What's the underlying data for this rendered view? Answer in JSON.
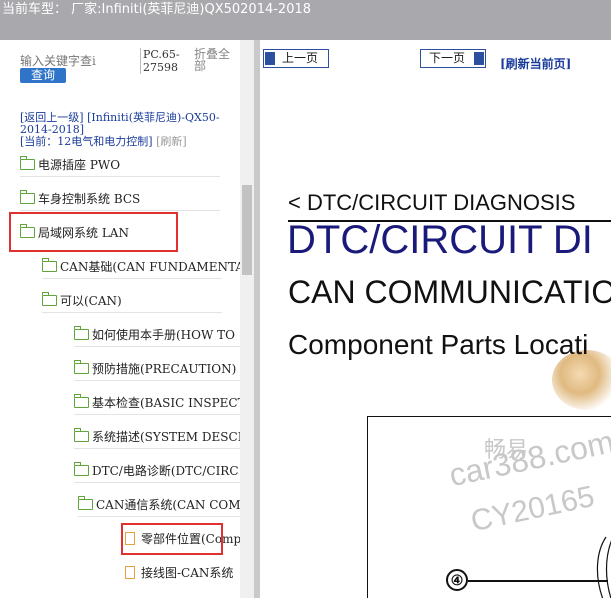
{
  "title_bar": {
    "text": "当前车型： 厂家:Infiniti(英菲尼迪)QX502014-2018"
  },
  "sidebar": {
    "search": {
      "placeholder": "输入关键字查i",
      "button_label": "查询"
    },
    "pc_label": "PC.65-27598",
    "collapse_all": "折叠全部",
    "nav": {
      "back": "[返回上一级]",
      "vehicle": "[Infiniti(英菲尼迪)-QX50-2014-2018]",
      "current": "[当前：12电气和电力控制]",
      "refresh": "[刷新]"
    },
    "tree": [
      {
        "label": "电源插座 PWO",
        "type": "folder",
        "indent": 0,
        "highlighted": false
      },
      {
        "label": "车身控制系统 BCS",
        "type": "folder",
        "indent": 0,
        "highlighted": false
      },
      {
        "label": "局域网系统 LAN",
        "type": "folder",
        "indent": 0,
        "highlighted": true
      },
      {
        "label": "CAN基础(CAN FUNDAMENTAL",
        "type": "folder",
        "indent": 1,
        "highlighted": false
      },
      {
        "label": "可以(CAN)",
        "type": "folder",
        "indent": 1,
        "highlighted": false
      },
      {
        "label": "如何使用本手册(HOW TO",
        "type": "folder",
        "indent": 2,
        "highlighted": false
      },
      {
        "label": "预防措施(PRECAUTION)",
        "type": "folder",
        "indent": 2,
        "highlighted": false
      },
      {
        "label": "基本检查(BASIC INSPECT",
        "type": "folder",
        "indent": 2,
        "highlighted": false
      },
      {
        "label": "系统描述(SYSTEM DESCR",
        "type": "folder",
        "indent": 2,
        "highlighted": false
      },
      {
        "label": "DTC/电路诊断(DTC/CIRC",
        "type": "folder",
        "indent": 2,
        "highlighted": false
      },
      {
        "label": "CAN通信系统(CAN COM",
        "type": "folder",
        "indent": 3,
        "highlighted": false
      },
      {
        "label": "零部件位置(Comp",
        "type": "file",
        "indent": 4,
        "highlighted": true
      },
      {
        "label": "接线图-CAN系统",
        "type": "file",
        "indent": 4,
        "highlighted": false
      }
    ]
  },
  "content": {
    "prev_button": "上一页",
    "next_button": "下一页",
    "refresh_page": "[刷新当前页]",
    "breadcrumb": "< DTC/CIRCUIT DIAGNOSIS",
    "title": "DTC/CIRCUIT DI",
    "subtitle": "CAN COMMUNICATIO",
    "heading": "Component Parts Locati",
    "callout": "④",
    "watermark": {
      "line1": "畅易",
      "line2": "car388.com",
      "line3": "CY20165"
    }
  }
}
